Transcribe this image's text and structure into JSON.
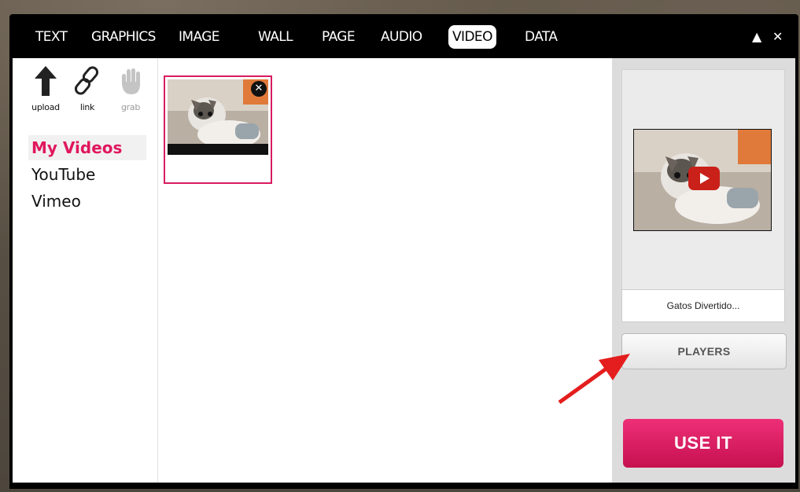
{
  "toolbar": {
    "tabs": [
      {
        "label": "TEXT"
      },
      {
        "label": "GRAPHICS"
      },
      {
        "label": "IMAGE"
      },
      {
        "label": "WALL"
      },
      {
        "label": "PAGE"
      },
      {
        "label": "AUDIO"
      },
      {
        "label": "VIDEO",
        "active": true
      },
      {
        "label": "DATA"
      }
    ],
    "collapse_icon": "▲",
    "close_icon": "✕"
  },
  "sidebar": {
    "tools": [
      {
        "label": "upload",
        "icon": "upload-arrow-icon"
      },
      {
        "label": "link",
        "icon": "link-chain-icon"
      },
      {
        "label": "grab",
        "icon": "hand-grab-icon"
      }
    ],
    "sources": [
      {
        "label": "My Videos",
        "active": true
      },
      {
        "label": "YouTube"
      },
      {
        "label": "Vimeo"
      }
    ]
  },
  "gallery": {
    "items": [
      {
        "title": "Gatos Divertido...",
        "selected": true,
        "remove_icon": "✕"
      }
    ]
  },
  "preview": {
    "caption": "Gatos Divertido...",
    "play_icon": "youtube-play-icon"
  },
  "actions": {
    "players_label": "PLAYERS",
    "use_it_label": "USE IT"
  },
  "colors": {
    "accent": "#d81b60",
    "use_it": "#e0175d",
    "toolbar_bg": "#000000",
    "right_pane_bg": "#dcdcdc",
    "annotation_arrow": "#e41e1e"
  }
}
